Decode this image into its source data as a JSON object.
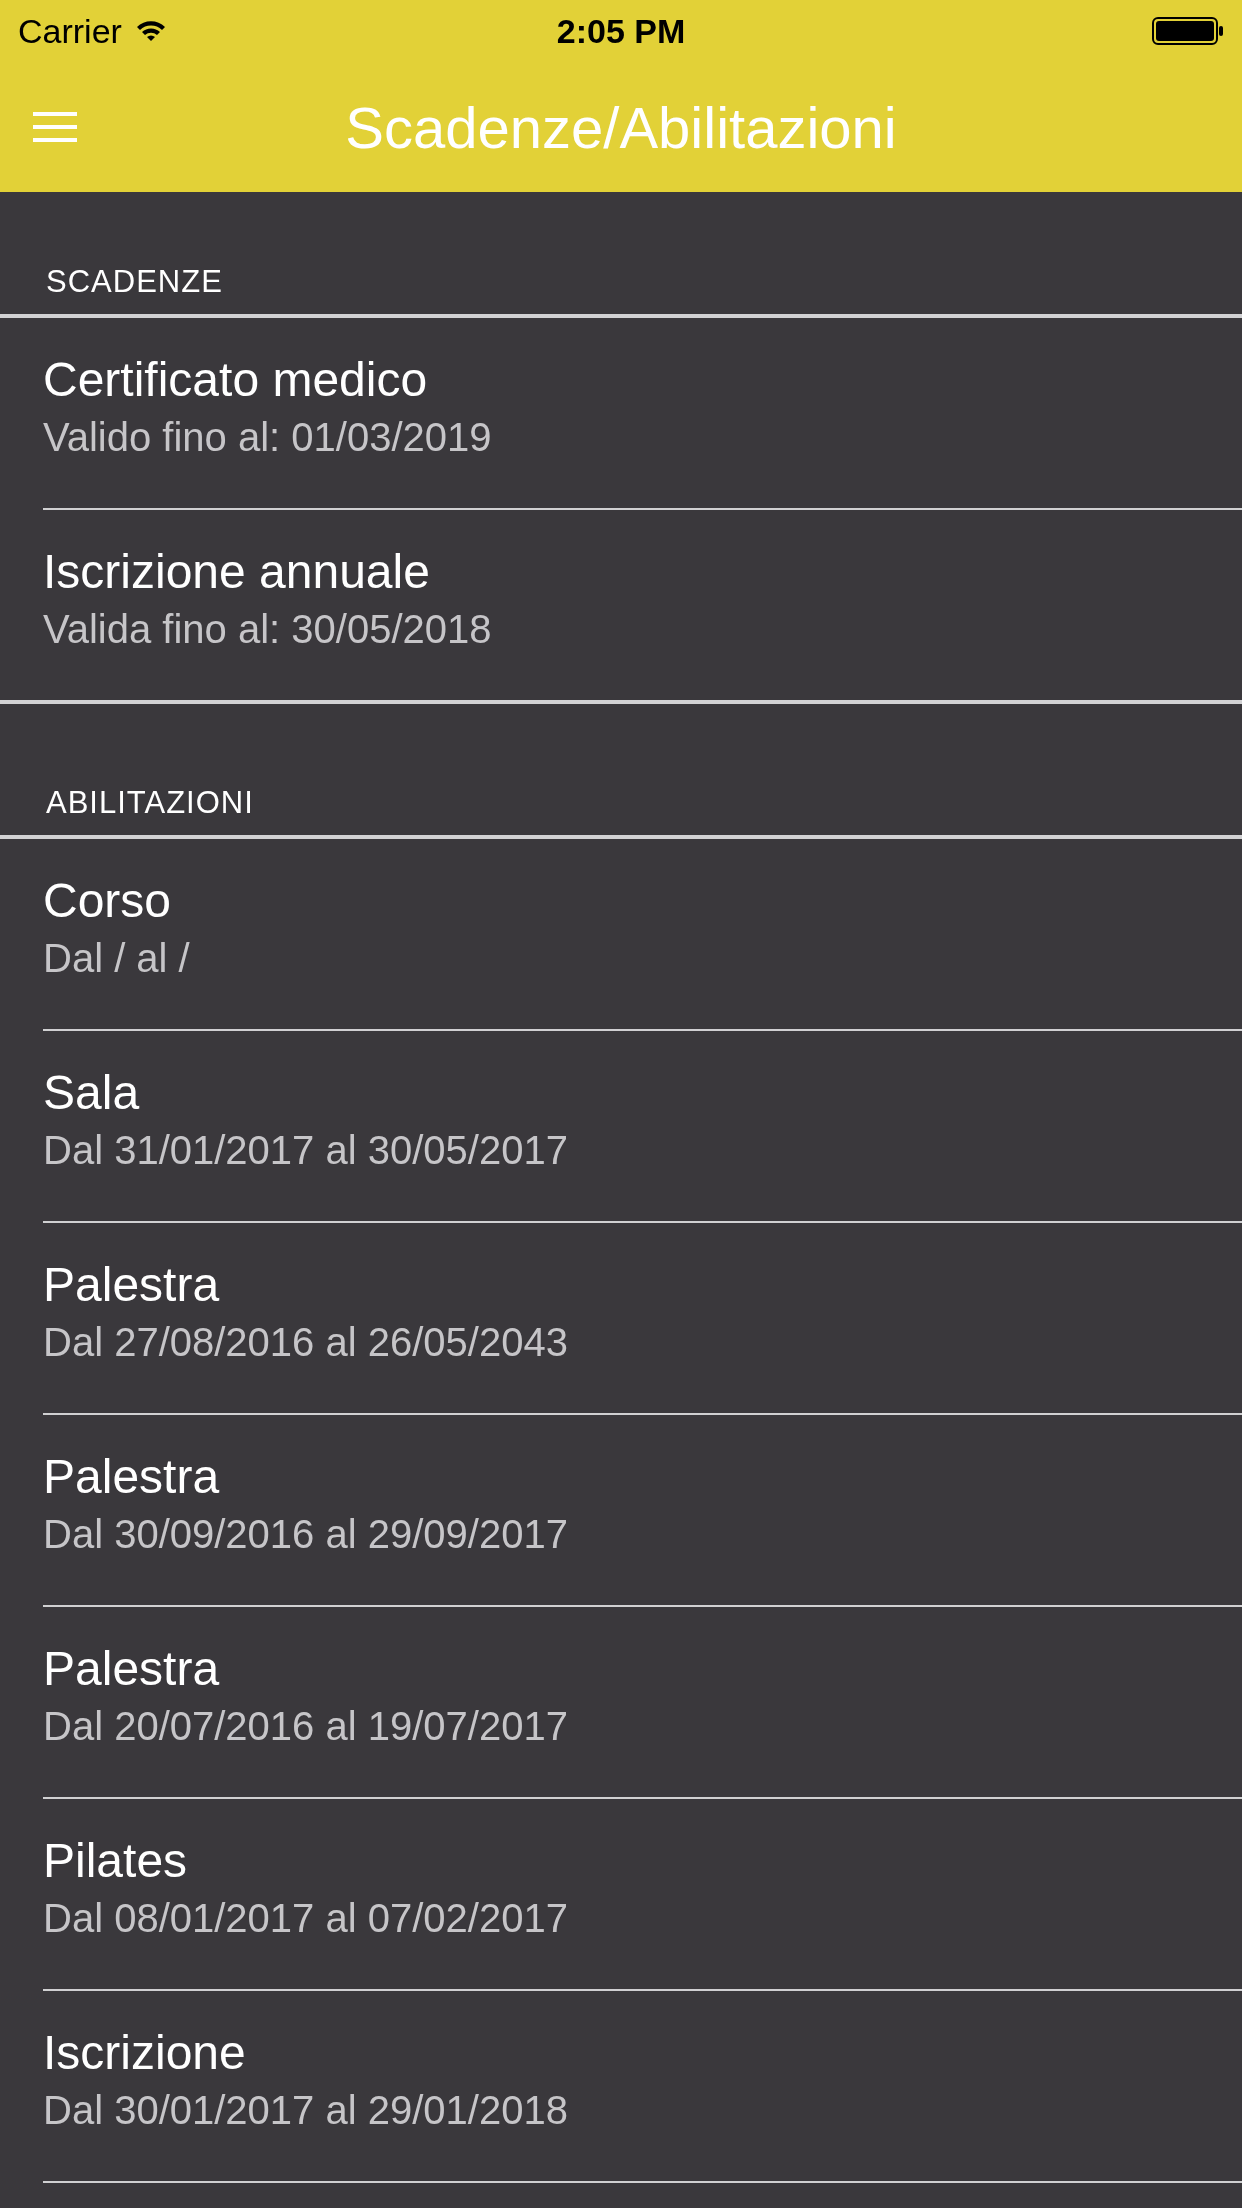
{
  "status_bar": {
    "carrier": "Carrier",
    "time": "2:05 PM"
  },
  "nav_bar": {
    "title": "Scadenze/Abilitazioni"
  },
  "sections": [
    {
      "header": "SCADENZE",
      "rows": [
        {
          "title": "Certificato medico",
          "subtitle": "Valido fino al: 01/03/2019"
        },
        {
          "title": "Iscrizione annuale",
          "subtitle": "Valida fino al: 30/05/2018"
        }
      ]
    },
    {
      "header": "ABILITAZIONI",
      "rows": [
        {
          "title": "Corso",
          "subtitle": "Dal / al /"
        },
        {
          "title": "Sala",
          "subtitle": "Dal 31/01/2017 al 30/05/2017"
        },
        {
          "title": "Palestra",
          "subtitle": "Dal 27/08/2016 al 26/05/2043"
        },
        {
          "title": "Palestra",
          "subtitle": "Dal 30/09/2016 al 29/09/2017"
        },
        {
          "title": "Palestra",
          "subtitle": "Dal 20/07/2016 al 19/07/2017"
        },
        {
          "title": "Pilates",
          "subtitle": "Dal 08/01/2017 al 07/02/2017"
        },
        {
          "title": "Iscrizione",
          "subtitle": "Dal 30/01/2017 al 29/01/2018"
        }
      ]
    }
  ]
}
